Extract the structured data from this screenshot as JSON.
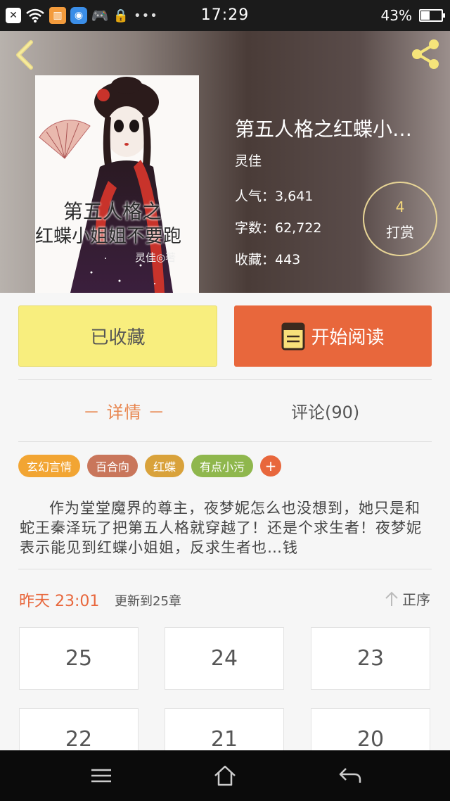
{
  "status_bar": {
    "time": "17:29",
    "battery": "43%",
    "battery_level": 0.43,
    "icons": [
      "close-app-icon",
      "wifi-icon",
      "book-app-icon",
      "browser-app-icon",
      "gamepad-icon",
      "lock-icon",
      "more-dots-icon"
    ]
  },
  "book": {
    "title": "第五人格之红蝶小…",
    "author": "灵佳",
    "popularity": "人气：3,641",
    "word_count": "字数：62,722",
    "favorites": "收藏：443",
    "tip_count": "4",
    "tip_label": "打赏",
    "cover_title_line1": "第五人格之",
    "cover_title_line2": "红蝶小姐姐不要跑",
    "cover_author": "灵佳◎著"
  },
  "actions": {
    "favorited_label": "已收藏",
    "read_label": "开始阅读"
  },
  "tabs": {
    "details": "－ 详情 －",
    "comments": "评论(90)"
  },
  "tags": [
    {
      "label": "玄幻言情",
      "color": "#f2a533"
    },
    {
      "label": "百合向",
      "color": "#c9765b"
    },
    {
      "label": "红蝶",
      "color": "#d9a23b"
    },
    {
      "label": "有点小污",
      "color": "#8fb74d"
    }
  ],
  "tag_add_label": "+",
  "description": "作为堂堂魔界的尊主，夜梦妮怎么也没想到，她只是和蛇王秦泽玩了把第五人格就穿越了！还是个求生者！夜梦妮表示能见到红蝶小姐姐，反求生者也…钱",
  "update": {
    "time": "昨天 23:01",
    "text": "更新到25章",
    "sort_label": "正序"
  },
  "chapters": [
    "25",
    "24",
    "23",
    "22",
    "21",
    "20"
  ],
  "colors": {
    "accent": "#e8673c",
    "favorite_button": "#f8ee7e",
    "tab_active": "#e8854e"
  }
}
